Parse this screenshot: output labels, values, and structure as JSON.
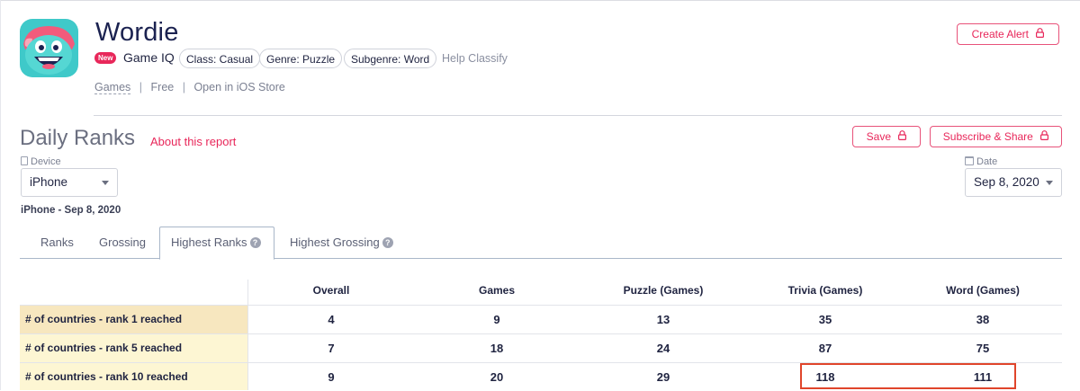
{
  "app": {
    "title": "Wordie",
    "new_badge": "New",
    "game_iq": "Game IQ",
    "chips": [
      "Class: Casual",
      "Genre: Puzzle",
      "Subgenre: Word"
    ],
    "help_classify": "Help Classify",
    "links": {
      "category": "Games",
      "price": "Free",
      "store": "Open in iOS Store"
    },
    "create_alert": "Create Alert"
  },
  "report": {
    "title": "Daily Ranks",
    "about": "About this report",
    "save": "Save",
    "subscribe": "Subscribe & Share",
    "device_label": "Device",
    "device_value": "iPhone",
    "date_label": "Date",
    "date_value": "Sep 8, 2020",
    "subtitle": "iPhone - Sep 8, 2020"
  },
  "tabs": [
    {
      "label": "Ranks"
    },
    {
      "label": "Grossing"
    },
    {
      "label": "Highest Ranks",
      "active": true
    },
    {
      "label": "Highest Grossing"
    }
  ],
  "table": {
    "columns": [
      "Overall",
      "Games",
      "Puzzle (Games)",
      "Trivia (Games)",
      "Word (Games)"
    ],
    "rows": [
      {
        "label": "# of countries - rank 1 reached",
        "values": [
          "4",
          "9",
          "13",
          "35",
          "38"
        ]
      },
      {
        "label": "# of countries - rank 5 reached",
        "values": [
          "7",
          "18",
          "24",
          "87",
          "75"
        ]
      },
      {
        "label": "# of countries - rank 10 reached",
        "values": [
          "9",
          "20",
          "29",
          "118",
          "111"
        ]
      }
    ]
  },
  "colors": {
    "accent": "#e8275a",
    "row1_bg": "#f7e7bf",
    "row_bg": "#fdf6d3",
    "highlight_border": "#e0452b"
  }
}
